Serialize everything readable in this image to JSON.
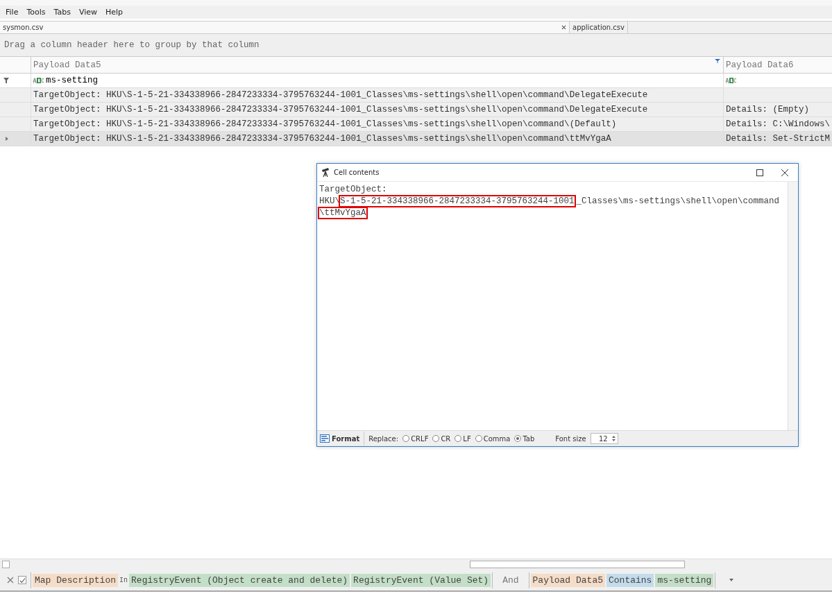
{
  "menu": [
    "File",
    "Tools",
    "Tabs",
    "View",
    "Help"
  ],
  "tabs": [
    {
      "label": "sysmon.csv",
      "selected": true,
      "closable": true
    },
    {
      "label": "application.csv",
      "selected": false,
      "closable": false
    }
  ],
  "group_panel": {
    "hint": "Drag a column header here to group by that column"
  },
  "table": {
    "columns": [
      {
        "label": "Payload Data5",
        "filtered": true
      },
      {
        "label": "Payload Data6",
        "filtered": false
      }
    ],
    "filter_row": [
      "ms-setting"
    ],
    "rows": [
      {
        "selected": false,
        "data5": "TargetObject: HKU\\S-1-5-21-334338966-2847233334-3795763244-1001_Classes\\ms-settings\\shell\\open\\command\\DelegateExecute"
      },
      {
        "selected": false,
        "data5": "TargetObject: HKU\\S-1-5-21-334338966-2847233334-3795763244-1001_Classes\\ms-settings\\shell\\open\\command\\DelegateExecute",
        "data6": "Details: (Empty)"
      },
      {
        "selected": false,
        "data5": "TargetObject: HKU\\S-1-5-21-334338966-2847233334-3795763244-1001_Classes\\ms-settings\\shell\\open\\command\\(Default)",
        "data6": "Details: C:\\Windows\\"
      },
      {
        "selected": true,
        "data5": "TargetObject: HKU\\S-1-5-21-334338966-2847233334-3795763244-1001_Classes\\ms-settings\\shell\\open\\command\\ttMvYgaA",
        "data6": "Details: Set-StrictM"
      }
    ]
  },
  "dialog": {
    "title": "Cell contents",
    "lines": [
      [
        {
          "text": "TargetObject:",
          "highlighted": false
        }
      ],
      [
        {
          "text": "HKU\\",
          "highlighted": false
        },
        {
          "text": "S-1-5-21-334338966-2847233334-3795763244-1001",
          "highlighted": true
        },
        {
          "text": "_Classes\\ms-settings\\shell\\open\\command",
          "highlighted": false
        }
      ],
      [
        {
          "text": "\\ttMvYgaA",
          "highlighted": true
        }
      ]
    ],
    "format_button": "Format",
    "replace_label": "Replace:",
    "options": [
      {
        "label": "CRLF",
        "selected": false
      },
      {
        "label": "CR",
        "selected": false
      },
      {
        "label": "LF",
        "selected": false
      },
      {
        "label": "Comma",
        "selected": false
      },
      {
        "label": "Tab",
        "selected": true
      }
    ],
    "font_size_label": "Font size",
    "font_size": "12"
  },
  "filter_bar": {
    "enabled": true,
    "items": [
      {
        "kind": "group",
        "items": [
          {
            "kind": "field",
            "text": "Map Description"
          },
          {
            "kind": "keyword",
            "text": "In"
          },
          {
            "kind": "value",
            "text": "RegistryEvent (Object create and delete)"
          },
          {
            "kind": "value",
            "text": "RegistryEvent (Value Set)"
          }
        ]
      },
      {
        "kind": "joiner",
        "text": "And"
      },
      {
        "kind": "group",
        "items": [
          {
            "kind": "field",
            "text": "Payload Data5"
          },
          {
            "kind": "operator",
            "text": "Contains"
          },
          {
            "kind": "value",
            "text": "ms-setting"
          }
        ]
      }
    ]
  }
}
